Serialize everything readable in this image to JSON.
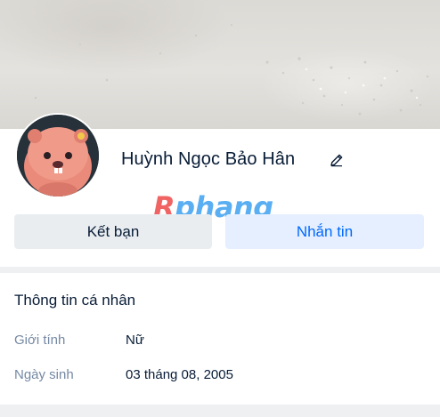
{
  "profile": {
    "name": "Huỳnh Ngọc Bảo Hân"
  },
  "actions": {
    "add_friend_label": "Kết bạn",
    "message_label": "Nhắn tin"
  },
  "watermark": {
    "text_r": "R",
    "text_rest": "phang"
  },
  "personal_info": {
    "title": "Thông tin cá nhân",
    "gender_label": "Giới tính",
    "gender_value": "Nữ",
    "birthday_label": "Ngày sinh",
    "birthday_value": "03 tháng 08, 2005"
  },
  "icons": {
    "edit": "pencil-icon"
  },
  "colors": {
    "primary_blue": "#0068ff",
    "message_button_bg": "#e5efff",
    "friend_button_bg": "#eaedf0",
    "label_gray": "#7589a3",
    "text_dark": "#081c36"
  }
}
